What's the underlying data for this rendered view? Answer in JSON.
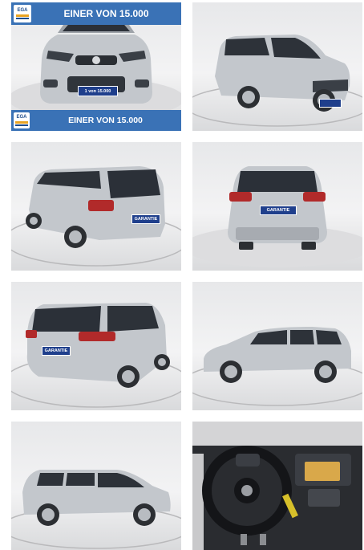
{
  "gallery": {
    "banner_text": "EINER VON 15.000",
    "banner_text_small": "EINER VON 15.000",
    "logo_text": "EGA",
    "plate_front": "1 von 15.000",
    "plate_garantie": "GARANTIE",
    "colors": {
      "banner_blue": "#3a72b6",
      "car_silver": "#c3c7cc",
      "plate_blue": "#1f3f8c",
      "logo_orange": "#e8a323"
    },
    "photos": [
      {
        "name": "front-view"
      },
      {
        "name": "front-right-view"
      },
      {
        "name": "rear-left-view"
      },
      {
        "name": "rear-view"
      },
      {
        "name": "rear-right-view"
      },
      {
        "name": "side-right-view"
      },
      {
        "name": "side-left-view"
      },
      {
        "name": "interior-dashboard-view"
      }
    ]
  }
}
